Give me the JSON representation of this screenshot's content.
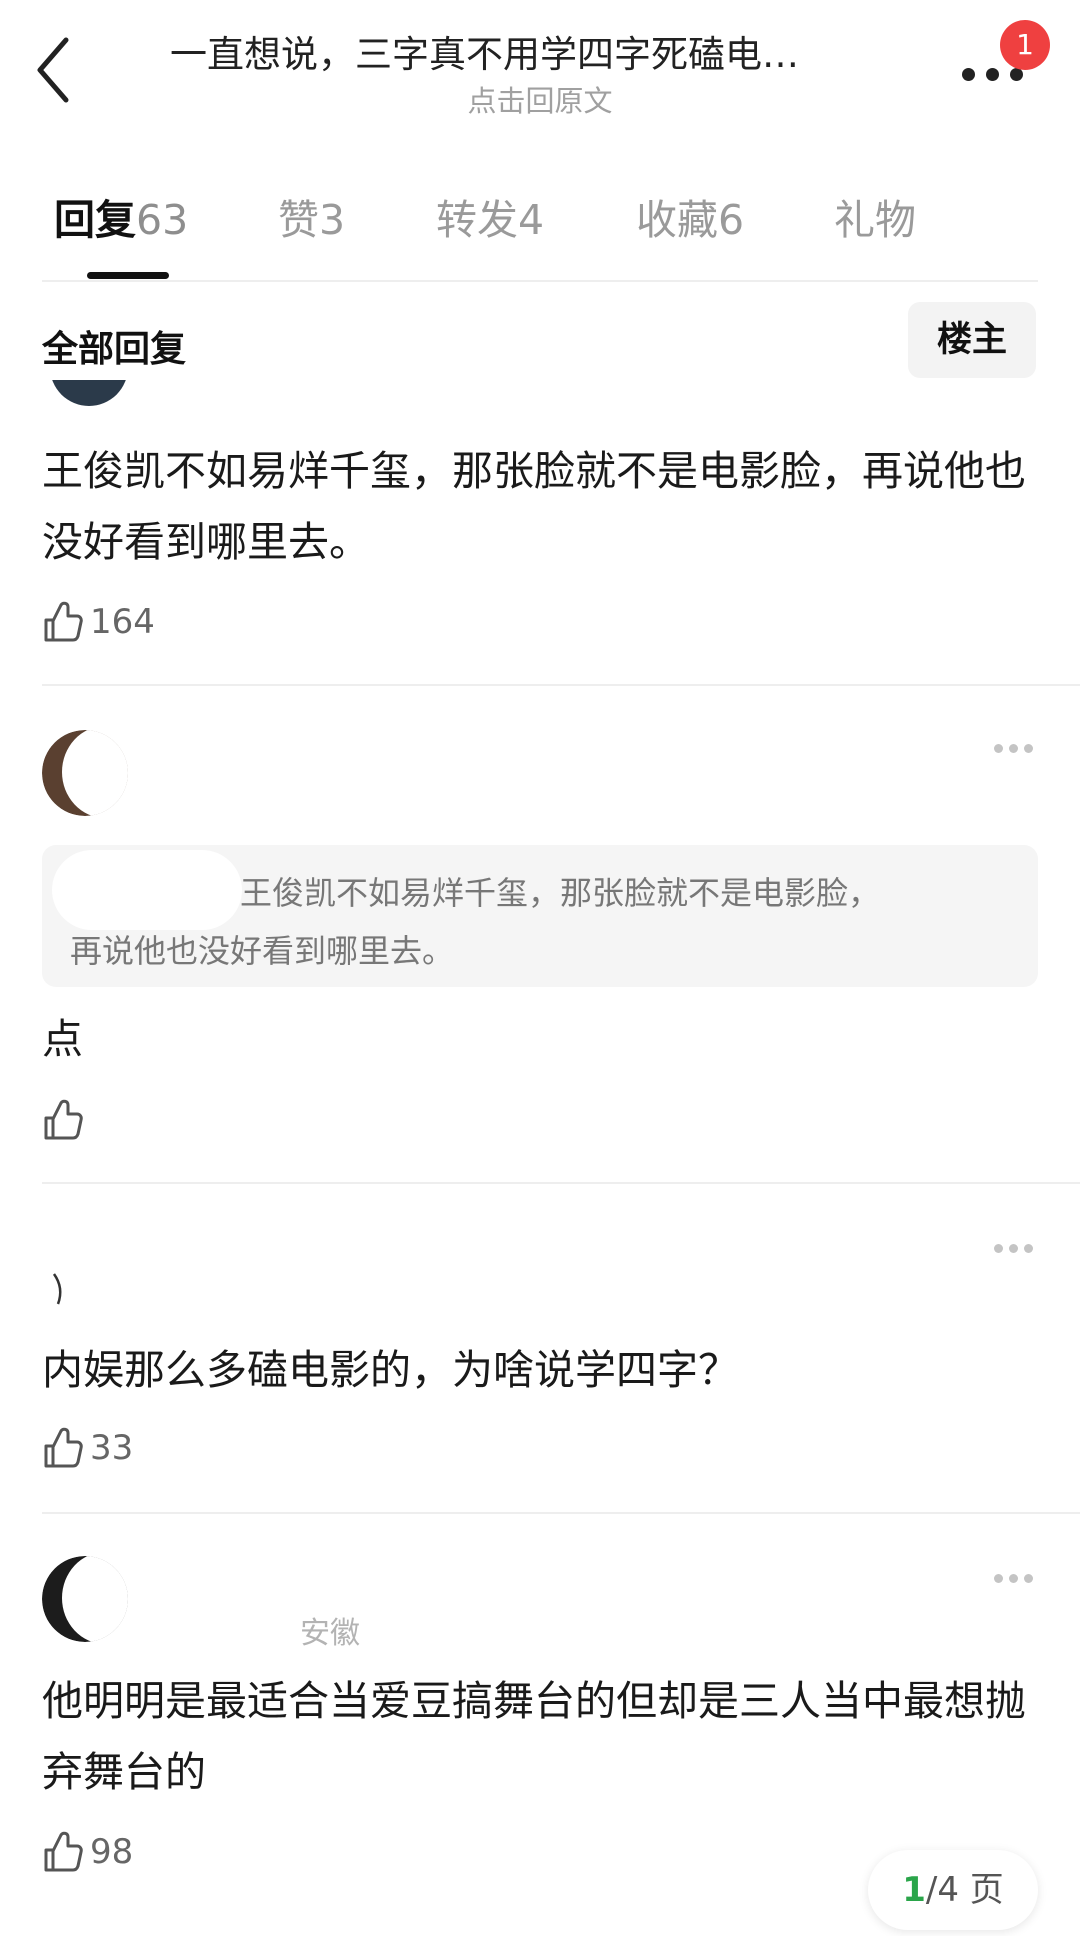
{
  "header": {
    "title": "一直想说，三字真不用学四字死磕电…",
    "subtitle": "点击回原文",
    "notification_count": "1"
  },
  "tabs": [
    {
      "label": "回复",
      "count": "63",
      "active": true
    },
    {
      "label": "赞",
      "count": "3"
    },
    {
      "label": "转发",
      "count": "4"
    },
    {
      "label": "收藏",
      "count": "6"
    },
    {
      "label": "礼物",
      "count": ""
    }
  ],
  "filter": {
    "label": "全部回复",
    "op_button": "楼主"
  },
  "comments": [
    {
      "meta": "",
      "text": "王俊凯不如易烊千玺，那张脸就不是电影脸，再说他也没好看到哪里去。",
      "likes": "164"
    },
    {
      "meta": "",
      "quote": "王俊凯不如易烊千玺，那张脸就不是电影脸，再说他也没好看到哪里去。",
      "quote_line1": "王俊凯不如易烊千玺，那张脸就不是电影脸，",
      "quote_line2": "再说他也没好看到哪里去。",
      "text": "点",
      "likes": ""
    },
    {
      "meta": "",
      "text": "内娱那么多磕电影的，为啥说学四字？",
      "likes": "33"
    },
    {
      "meta": "安徽",
      "text": "他明明是最适合当爱豆搞舞台的但却是三人当中最想抛弃舞台的",
      "likes": "98"
    }
  ],
  "pager": {
    "current": "1",
    "total_text": "/4 页"
  },
  "colors": {
    "badge": "#ef4040",
    "pager_current": "#2aa54a",
    "active_tab": "#111111",
    "inactive_tab": "#9a9a9a"
  }
}
